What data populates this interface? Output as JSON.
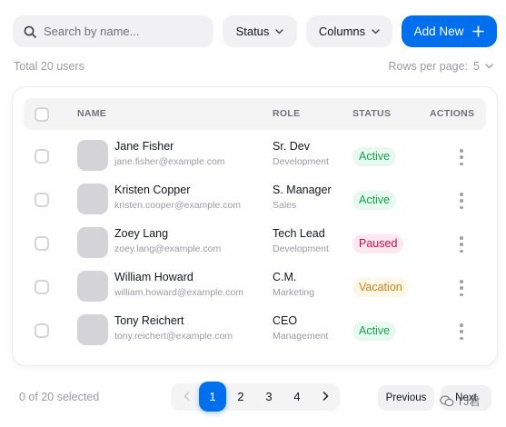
{
  "search": {
    "placeholder": "Search by name..."
  },
  "filters": {
    "status_label": "Status",
    "columns_label": "Columns"
  },
  "add_button": {
    "label": "Add New"
  },
  "summary": {
    "total_text": "Total 20 users",
    "rows_per_page_label": "Rows per page:",
    "rows_per_page_value": "5"
  },
  "table": {
    "headers": {
      "name": "NAME",
      "role": "ROLE",
      "status": "STATUS",
      "actions": "ACTIONS"
    },
    "rows": [
      {
        "name": "Jane Fisher",
        "email": "jane.fisher@example.com",
        "role": "Sr. Dev",
        "team": "Development",
        "status": "Active",
        "status_kind": "active"
      },
      {
        "name": "Kristen Copper",
        "email": "kristen.cooper@example.com",
        "role": "S. Manager",
        "team": "Sales",
        "status": "Active",
        "status_kind": "active"
      },
      {
        "name": "Zoey Lang",
        "email": "zoey.lang@example.com",
        "role": "Tech Lead",
        "team": "Development",
        "status": "Paused",
        "status_kind": "paused"
      },
      {
        "name": "William Howard",
        "email": "william.howard@example.com",
        "role": "C.M.",
        "team": "Marketing",
        "status": "Vacation",
        "status_kind": "vacation"
      },
      {
        "name": "Tony Reichert",
        "email": "tony.reichert@example.com",
        "role": "CEO",
        "team": "Management",
        "status": "Active",
        "status_kind": "active"
      }
    ]
  },
  "pagination": {
    "selected_text": "0 of 20 selected",
    "pages": [
      "1",
      "2",
      "3",
      "4"
    ],
    "current_page": "1",
    "previous_label": "Previous",
    "next_label": "Next"
  },
  "watermark": {
    "text": "TJ君"
  },
  "colors": {
    "primary": "#006fee",
    "active": "#12a150",
    "paused": "#c20e4d",
    "vacation": "#c4841d"
  }
}
